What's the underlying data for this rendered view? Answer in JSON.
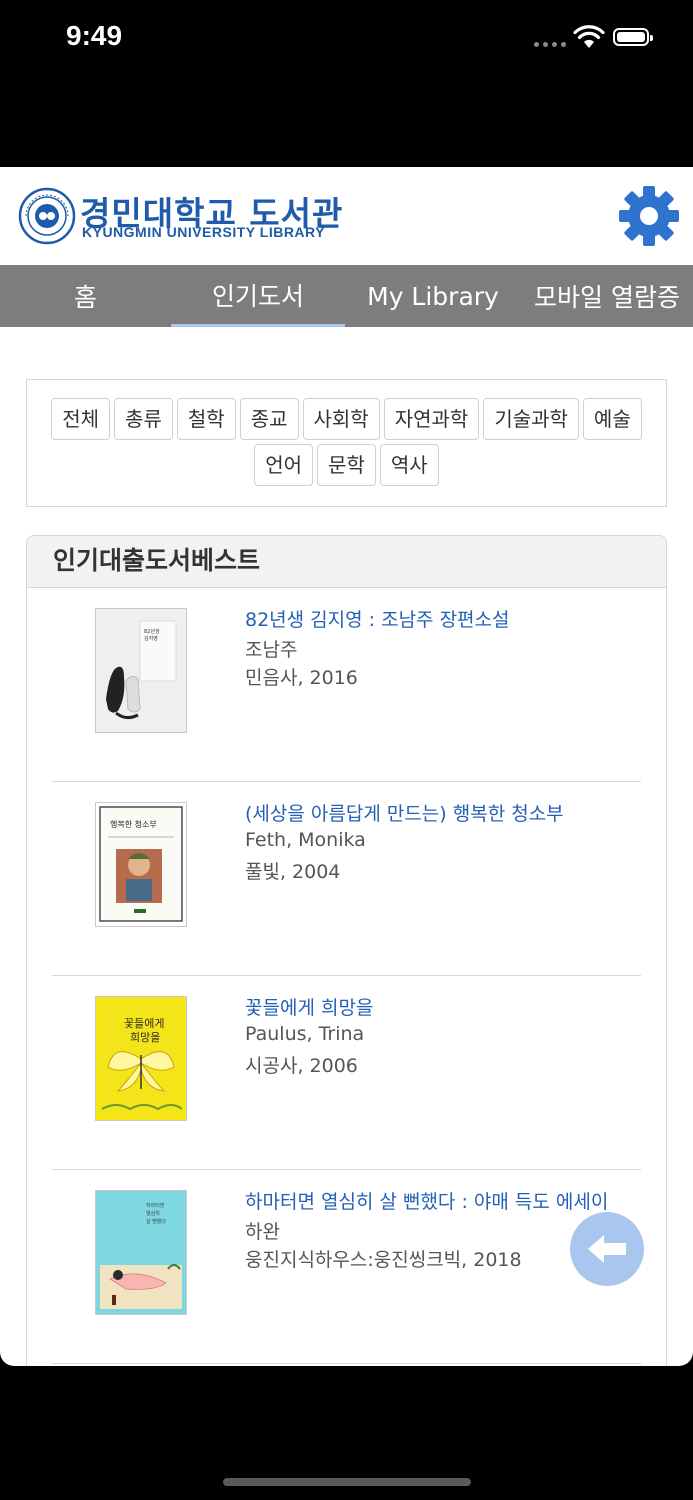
{
  "status_bar": {
    "time": "9:49"
  },
  "header": {
    "logo_title": "경민대학교 도서관",
    "logo_subtitle": "KYUNGMIN UNIVERSITY  LIBRARY",
    "accent_color": "#1e5ba8",
    "settings_icon": "gear-icon"
  },
  "nav": {
    "tabs": [
      {
        "label": "홈"
      },
      {
        "label": "인기도서",
        "active": true
      },
      {
        "label": "My Library"
      },
      {
        "label": "모바일 열람증"
      }
    ]
  },
  "filters": {
    "chips": [
      "전체",
      "총류",
      "철학",
      "종교",
      "사회학",
      "자연과학",
      "기술과학",
      "예술",
      "언어",
      "문학",
      "역사"
    ]
  },
  "panel": {
    "title": "인기대출도서베스트",
    "books": [
      {
        "title": "82년생 김지영 : 조남주 장편소설",
        "author": "조남주",
        "publisher": "민음사, 2016"
      },
      {
        "title": "(세상을 아름답게 만드는) 행복한 청소부",
        "author": "Feth, Monika",
        "publisher": "풀빛, 2004"
      },
      {
        "title": "꽃들에게 희망을",
        "author": "Paulus, Trina",
        "publisher": "시공사, 2006"
      },
      {
        "title": "하마터면 열심히 살 뻔했다 : 야매 득도 에세이",
        "author": "하완",
        "publisher": "웅진지식하우스:웅진씽크빅, 2018"
      }
    ]
  },
  "floating": {
    "back_icon": "arrow-left-icon"
  }
}
